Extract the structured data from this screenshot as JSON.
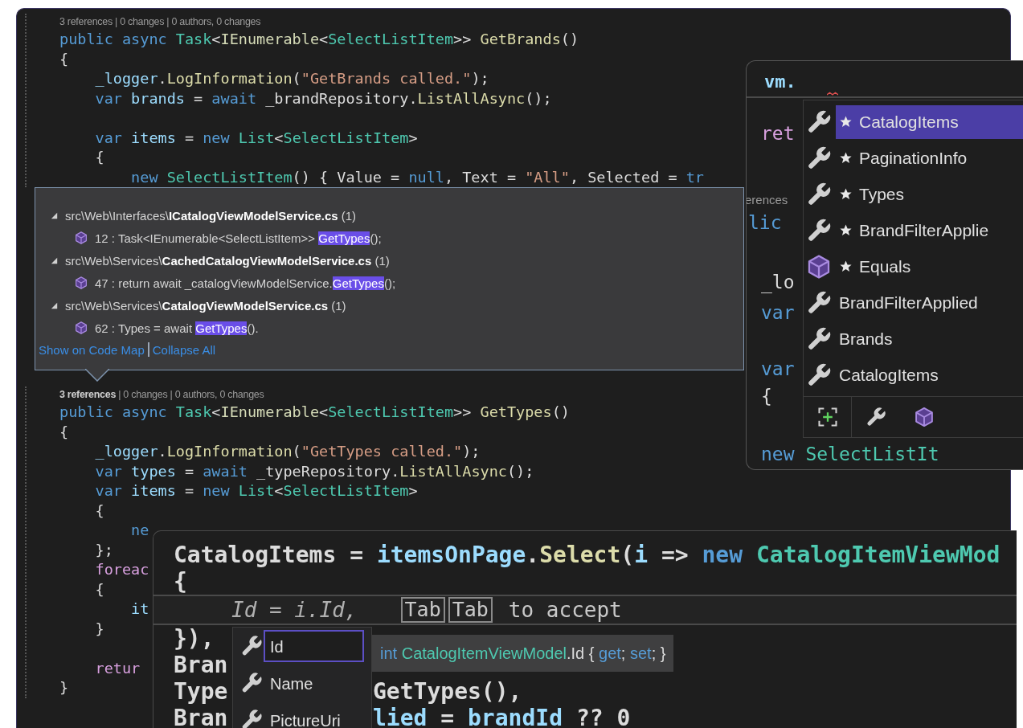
{
  "editor": {
    "lines_before": [
      {
        "kind": "lens",
        "text": "3 references | 0 changes | 0 authors, 0 changes"
      },
      {
        "kind": "code",
        "tokens": [
          {
            "kind": "kw",
            "text": "public async "
          },
          {
            "kind": "ty",
            "text": "Task"
          },
          {
            "kind": "p",
            "text": "<"
          },
          {
            "kind": "if",
            "text": "IEnumerable"
          },
          {
            "kind": "p",
            "text": "<"
          },
          {
            "kind": "ty",
            "text": "SelectListItem"
          },
          {
            "kind": "p",
            "text": ">> "
          },
          {
            "kind": "fn",
            "text": "GetBrands"
          },
          {
            "kind": "p",
            "text": "()"
          }
        ]
      },
      {
        "kind": "code",
        "tokens": [
          {
            "kind": "p",
            "text": "{"
          }
        ]
      },
      {
        "kind": "code",
        "tokens": [
          {
            "kind": "var",
            "text": "    _logger"
          },
          {
            "kind": "p",
            "text": "."
          },
          {
            "kind": "fn",
            "text": "LogInformation"
          },
          {
            "kind": "p",
            "text": "("
          },
          {
            "kind": "str",
            "text": "\"GetBrands called.\""
          },
          {
            "kind": "p",
            "text": ");"
          }
        ]
      },
      {
        "kind": "code",
        "tokens": [
          {
            "kind": "kw",
            "text": "    var "
          },
          {
            "kind": "var",
            "text": "brands"
          },
          {
            "kind": "p",
            "text": " = "
          },
          {
            "kind": "kw",
            "text": "await "
          },
          {
            "kind": "p",
            "text": "_brandRepository."
          },
          {
            "kind": "fn",
            "text": "ListAllAsync"
          },
          {
            "kind": "p",
            "text": "();"
          }
        ]
      },
      {
        "kind": "blank"
      },
      {
        "kind": "code",
        "tokens": [
          {
            "kind": "kw",
            "text": "    var "
          },
          {
            "kind": "var",
            "text": "items"
          },
          {
            "kind": "p",
            "text": " = "
          },
          {
            "kind": "kw",
            "text": "new "
          },
          {
            "kind": "ty",
            "text": "List"
          },
          {
            "kind": "p",
            "text": "<"
          },
          {
            "kind": "ty",
            "text": "SelectListItem"
          },
          {
            "kind": "p",
            "text": ">"
          }
        ]
      },
      {
        "kind": "code",
        "tokens": [
          {
            "kind": "p",
            "text": "    {"
          }
        ]
      },
      {
        "kind": "code",
        "tokens": [
          {
            "kind": "kw",
            "text": "        new "
          },
          {
            "kind": "ty",
            "text": "SelectListItem"
          },
          {
            "kind": "p",
            "text": "() { Value = "
          },
          {
            "kind": "kw",
            "text": "null"
          },
          {
            "kind": "p",
            "text": ", Text = "
          },
          {
            "kind": "str",
            "text": "\"All\""
          },
          {
            "kind": "p",
            "text": ", Selected = "
          },
          {
            "kind": "kw",
            "text": "tr"
          }
        ]
      }
    ],
    "references": {
      "groups": [
        {
          "expanded": true,
          "path": "src\\Web\\Interfaces\\",
          "file": "ICatalogViewModelService.cs",
          "count": "(1)",
          "results": [
            {
              "before": "12 : Task<IEnumerable<SelectListItem>> ",
              "match": "GetTypes",
              "after": "();"
            }
          ]
        },
        {
          "expanded": true,
          "path": "src\\Web\\Services\\",
          "file": "CachedCatalogViewModelService.cs",
          "count": "(1)",
          "results": [
            {
              "before": "47 : return await _catalogViewModelService.",
              "match": "GetTypes",
              "after": "();"
            }
          ]
        },
        {
          "expanded": true,
          "path": "src\\Web\\Services\\",
          "file": "CatalogViewModelService.cs",
          "count": "(1)",
          "results": [
            {
              "before": "62 : Types = await ",
              "match": "GetTypes",
              "after": "()."
            }
          ]
        }
      ],
      "links": [
        "Show on Code Map",
        "Collapse All"
      ]
    },
    "lines_after": [
      {
        "kind": "lens",
        "text": "**3 references** | 0 changes | 0 authors, 0 changes"
      },
      {
        "kind": "code",
        "tokens": [
          {
            "kind": "kw",
            "text": "public async "
          },
          {
            "kind": "ty",
            "text": "Task"
          },
          {
            "kind": "p",
            "text": "<"
          },
          {
            "kind": "if",
            "text": "IEnumerable"
          },
          {
            "kind": "p",
            "text": "<"
          },
          {
            "kind": "ty",
            "text": "SelectListItem"
          },
          {
            "kind": "p",
            "text": ">> "
          },
          {
            "kind": "fn",
            "text": "GetTypes"
          },
          {
            "kind": "p",
            "text": "()"
          }
        ]
      },
      {
        "kind": "code",
        "tokens": [
          {
            "kind": "p",
            "text": "{"
          }
        ]
      },
      {
        "kind": "code",
        "tokens": [
          {
            "kind": "var",
            "text": "    _logger"
          },
          {
            "kind": "p",
            "text": "."
          },
          {
            "kind": "fn",
            "text": "LogInformation"
          },
          {
            "kind": "p",
            "text": "("
          },
          {
            "kind": "str",
            "text": "\"GetTypes called.\""
          },
          {
            "kind": "p",
            "text": ");"
          }
        ]
      },
      {
        "kind": "code",
        "tokens": [
          {
            "kind": "kw",
            "text": "    var "
          },
          {
            "kind": "var",
            "text": "types"
          },
          {
            "kind": "p",
            "text": " = "
          },
          {
            "kind": "kw",
            "text": "await "
          },
          {
            "kind": "p",
            "text": "_typeRepository."
          },
          {
            "kind": "fn",
            "text": "ListAllAsync"
          },
          {
            "kind": "p",
            "text": "();"
          }
        ]
      },
      {
        "kind": "code",
        "tokens": [
          {
            "kind": "kw",
            "text": "    var "
          },
          {
            "kind": "var",
            "text": "items"
          },
          {
            "kind": "p",
            "text": " = "
          },
          {
            "kind": "kw",
            "text": "new "
          },
          {
            "kind": "ty",
            "text": "List"
          },
          {
            "kind": "p",
            "text": "<"
          },
          {
            "kind": "ty",
            "text": "SelectListItem"
          },
          {
            "kind": "p",
            "text": ">"
          }
        ]
      },
      {
        "kind": "code",
        "tokens": [
          {
            "kind": "p",
            "text": "    {"
          }
        ]
      },
      {
        "kind": "code",
        "tokens": [
          {
            "kind": "kw",
            "text": "        ne"
          }
        ]
      },
      {
        "kind": "code",
        "tokens": [
          {
            "kind": "p",
            "text": "    };"
          }
        ]
      },
      {
        "kind": "code",
        "tokens": [
          {
            "kind": "ctl",
            "text": "    foreac"
          }
        ]
      },
      {
        "kind": "code",
        "tokens": [
          {
            "kind": "p",
            "text": "    {"
          }
        ]
      },
      {
        "kind": "code",
        "tokens": [
          {
            "kind": "var",
            "text": "        it"
          }
        ]
      },
      {
        "kind": "code",
        "tokens": [
          {
            "kind": "p",
            "text": "    }"
          }
        ]
      },
      {
        "kind": "blank"
      },
      {
        "kind": "code",
        "tokens": [
          {
            "kind": "ctl",
            "text": "    retur"
          }
        ]
      },
      {
        "kind": "code",
        "tokens": [
          {
            "kind": "p",
            "text": "}"
          }
        ]
      }
    ]
  },
  "peek_window": {
    "header": "vm.",
    "fragments": [
      [
        {
          "kind": "ctl",
          "text": "ret"
        }
      ],
      [
        {
          "kind": "lens",
          "text": "erences"
        }
      ],
      [
        {
          "kind": "kw",
          "text": "lic"
        }
      ],
      [
        {
          "kind": "p",
          "text": "_lo"
        }
      ],
      [
        {
          "kind": "kw",
          "text": "var"
        }
      ],
      [
        {
          "kind": "kw",
          "text": "var"
        }
      ],
      [
        {
          "kind": "p",
          "text": "{"
        }
      ],
      [
        {
          "kind": "kw",
          "text": "new "
        },
        {
          "kind": "ty",
          "text": "SelectListIt"
        }
      ]
    ],
    "completion": {
      "items": [
        {
          "kind": "property",
          "starred": true,
          "label": "CatalogItems",
          "selected": true
        },
        {
          "kind": "property",
          "starred": true,
          "label": "PaginationInfo",
          "selected": false
        },
        {
          "kind": "property",
          "starred": true,
          "label": "Types",
          "selected": false
        },
        {
          "kind": "property",
          "starred": true,
          "label": "BrandFilterApplie",
          "selected": false
        },
        {
          "kind": "method",
          "starred": true,
          "label": "Equals",
          "selected": false
        },
        {
          "kind": "property",
          "starred": false,
          "label": "BrandFilterApplied",
          "selected": false
        },
        {
          "kind": "property",
          "starred": false,
          "label": "Brands",
          "selected": false
        },
        {
          "kind": "property",
          "starred": false,
          "label": "CatalogItems",
          "selected": false
        }
      ],
      "filters": [
        {
          "kind": "snippet"
        },
        {
          "kind": "property"
        },
        {
          "kind": "method"
        }
      ]
    }
  },
  "inline_window": {
    "lines": [
      {
        "kind": "code",
        "tokens": [
          {
            "kind": "p",
            "text": "CatalogItems = "
          },
          {
            "kind": "var",
            "text": "itemsOnPage"
          },
          {
            "kind": "p",
            "text": "."
          },
          {
            "kind": "fn",
            "text": "Select"
          },
          {
            "kind": "p",
            "text": "("
          },
          {
            "kind": "var",
            "text": "i"
          },
          {
            "kind": "p",
            "text": " => "
          },
          {
            "kind": "kw",
            "text": "new "
          },
          {
            "kind": "ty",
            "text": "CatalogItemViewMod"
          }
        ]
      },
      {
        "kind": "code",
        "tokens": [
          {
            "kind": "p",
            "text": "{"
          }
        ]
      },
      {
        "kind": "suggestion",
        "ghost": "Id = i.Id,",
        "keys": [
          "Tab",
          "Tab"
        ],
        "hint": "to accept"
      },
      {
        "kind": "code",
        "tokens": [
          {
            "kind": "p",
            "text": "}),"
          }
        ]
      },
      {
        "kind": "code",
        "tokens": [
          {
            "kind": "p",
            "text": "Bran"
          }
        ]
      },
      {
        "kind": "split",
        "left": [
          {
            "kind": "p",
            "text": "Type"
          }
        ],
        "right": [
          {
            "kind": "p",
            "text": "GetTypes(),"
          }
        ]
      },
      {
        "kind": "split",
        "left": [
          {
            "kind": "p",
            "text": "Bran"
          }
        ],
        "right": [
          {
            "kind": "var",
            "text": "lied"
          },
          {
            "kind": "p",
            "text": " = "
          },
          {
            "kind": "var",
            "text": "brandId"
          },
          {
            "kind": "p",
            "text": " ?? 0"
          }
        ]
      }
    ],
    "completion": {
      "items": [
        {
          "kind": "property",
          "label": "Id",
          "selected": true
        },
        {
          "kind": "property",
          "label": "Name",
          "selected": false
        },
        {
          "kind": "property",
          "label": "PictureUri",
          "selected": false
        }
      ]
    },
    "tooltip": [
      {
        "kind": "kw",
        "text": "int "
      },
      {
        "kind": "ty",
        "text": "CatalogItemViewModel"
      },
      {
        "kind": "p",
        "text": ".Id { "
      },
      {
        "kind": "kw",
        "text": "get"
      },
      {
        "kind": "p",
        "text": "; "
      },
      {
        "kind": "kw",
        "text": "set"
      },
      {
        "kind": "p",
        "text": "; }"
      }
    ]
  }
}
